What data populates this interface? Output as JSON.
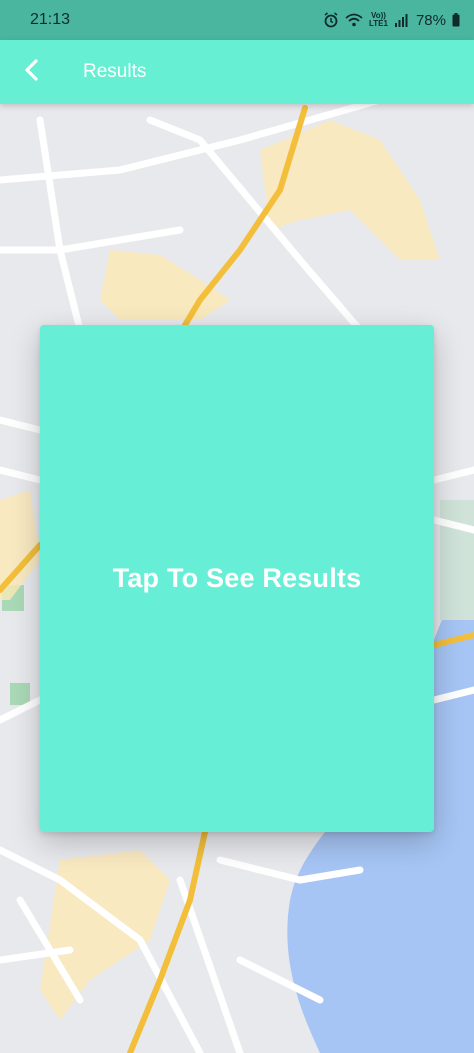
{
  "status_bar": {
    "time": "21:13",
    "alarm_icon": "alarm-icon",
    "wifi_icon": "wifi-icon",
    "network_label_top": "Vo))",
    "network_label_bottom": "LTE1",
    "signal_icon": "signal-icon",
    "battery_percent": "78%",
    "battery_icon": "battery-icon"
  },
  "app_bar": {
    "back_icon": "chevron-left-icon",
    "title": "Results",
    "background_color": "#67efd4"
  },
  "card": {
    "label": "Tap To See Results",
    "background_color": "#66efd6"
  },
  "map": {
    "water_color": "#a7c7f5",
    "highway_color": "#f4c041",
    "land_color": "#e9eaee"
  }
}
